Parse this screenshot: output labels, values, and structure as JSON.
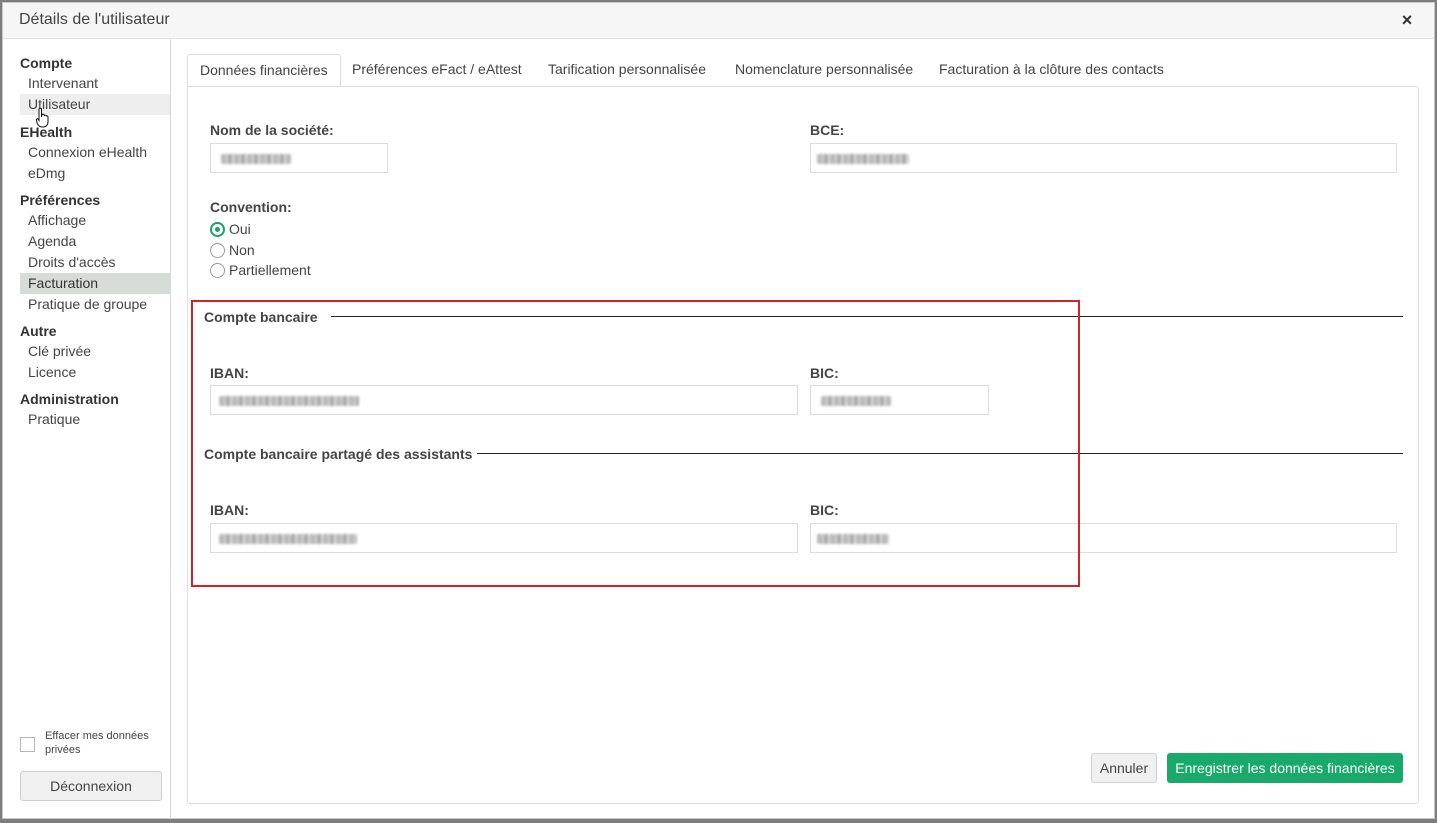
{
  "window": {
    "title": "Détails de l'utilisateur",
    "close_label": "×"
  },
  "sidebar": {
    "groups": [
      {
        "title": "Compte",
        "items": [
          "Intervenant",
          "Utilisateur"
        ]
      },
      {
        "title": "EHealth",
        "items": [
          "Connexion eHealth",
          "eDmg"
        ]
      },
      {
        "title": "Préférences",
        "items": [
          "Affichage",
          "Agenda",
          "Droits d'accès",
          "Facturation",
          "Pratique de groupe"
        ]
      },
      {
        "title": "Autre",
        "items": [
          "Clé privée",
          "Licence"
        ]
      },
      {
        "title": "Administration",
        "items": [
          "Pratique"
        ]
      }
    ],
    "active_item": "Facturation",
    "hover_item": "Utilisateur",
    "clear_private_data_label": "Effacer mes données privées",
    "logout_label": "Déconnexion"
  },
  "tabs": [
    {
      "label": "Données financières",
      "active": true
    },
    {
      "label": "Préférences eFact / eAttest",
      "active": false
    },
    {
      "label": "Tarification personnalisée",
      "active": false
    },
    {
      "label": "Nomenclature personnalisée",
      "active": false
    },
    {
      "label": "Facturation à la clôture des contacts",
      "active": false
    }
  ],
  "form": {
    "company_name_label": "Nom de la société:",
    "bce_label": "BCE:",
    "convention_label": "Convention:",
    "convention_options": [
      "Oui",
      "Non",
      "Partiellement"
    ],
    "convention_selected": "Oui",
    "bank_account_title": "Compte bancaire",
    "iban_label": "IBAN:",
    "bic_label": "BIC:",
    "shared_account_title": "Compte bancaire partagé des assistants",
    "shared_iban_label": "IBAN:",
    "shared_bic_label": "BIC:"
  },
  "actions": {
    "cancel_label": "Annuler",
    "save_label": "Enregistrer les données financières"
  },
  "colors": {
    "accent": "#18a96b",
    "highlight": "#d3232a"
  }
}
